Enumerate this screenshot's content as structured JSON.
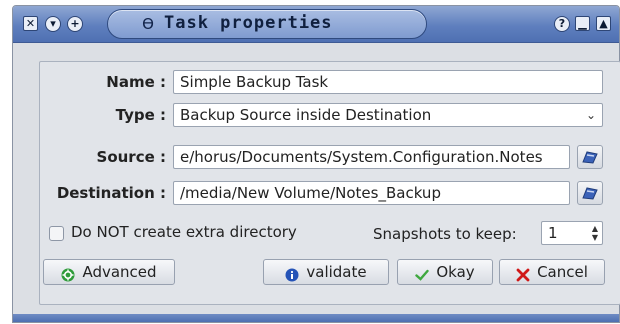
{
  "window": {
    "title": "Task properties",
    "titlebar_buttons_left": [
      "close-icon",
      "menu-icon",
      "plus-icon"
    ],
    "titlebar_buttons_right": [
      "help-icon",
      "minimize-icon",
      "maximize-icon"
    ]
  },
  "form": {
    "name_label": "Name :",
    "name_value": "Simple Backup Task",
    "type_label": "Type :",
    "type_value": "Backup Source inside Destination",
    "source_label": "Source :",
    "source_value": "e/horus/Documents/System.Configuration.Notes",
    "destination_label": "Destination :",
    "destination_value": "/media/New Volume/Notes_Backup",
    "no_extra_dir_label": "Do NOT create extra directory",
    "no_extra_dir_checked": false,
    "snapshots_label": "Snapshots to keep:",
    "snapshots_value": "1"
  },
  "buttons": {
    "advanced": "Advanced",
    "validate": "validate",
    "okay": "Okay",
    "cancel": "Cancel"
  },
  "colors": {
    "titlebar": "#5f7fbe",
    "window_bg": "#dcdfe4",
    "okay_check": "#3fa83f",
    "cancel_x": "#d01818",
    "validate_info": "#2553b7",
    "advanced_icon": "#2e9b3a"
  }
}
